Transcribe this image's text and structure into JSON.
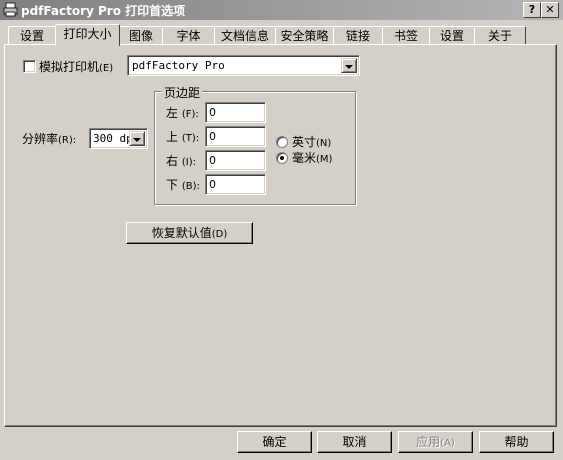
{
  "window": {
    "title": "pdfFactory Pro 打印首选项",
    "help_button": "?",
    "close_button": "✕"
  },
  "tabs": [
    {
      "label": "设置"
    },
    {
      "label": "打印大小",
      "active": true
    },
    {
      "label": "图像"
    },
    {
      "label": "字体"
    },
    {
      "label": "文档信息"
    },
    {
      "label": "安全策略"
    },
    {
      "label": "链接"
    },
    {
      "label": "书签"
    },
    {
      "label": "设置"
    },
    {
      "label": "关于"
    }
  ],
  "emulate": {
    "checkbox_label": "模拟打印机",
    "checkbox_hotkey": "(E)",
    "checked": false,
    "printer_value": "pdfFactory Pro"
  },
  "resolution": {
    "label": "分辨率",
    "hotkey": "(R):",
    "value": "300 dp"
  },
  "margins": {
    "group_title": "页边距",
    "left_label": "左",
    "left_hotkey": "(F):",
    "left_value": "0",
    "top_label": "上",
    "top_hotkey": "(T):",
    "top_value": "0",
    "right_label": "右",
    "right_hotkey": "(I):",
    "right_value": "0",
    "bottom_label": "下",
    "bottom_hotkey": "(B):",
    "bottom_value": "0",
    "units": [
      {
        "label": "英寸",
        "hotkey": "(N)",
        "selected": false
      },
      {
        "label": "毫米",
        "hotkey": "(M)",
        "selected": true
      }
    ]
  },
  "restore_button": {
    "label": "恢复默认值",
    "hotkey": "(D)"
  },
  "footer": {
    "ok": "确定",
    "cancel": "取消",
    "apply": "应用",
    "apply_hotkey": "(A)",
    "help": "帮助"
  }
}
